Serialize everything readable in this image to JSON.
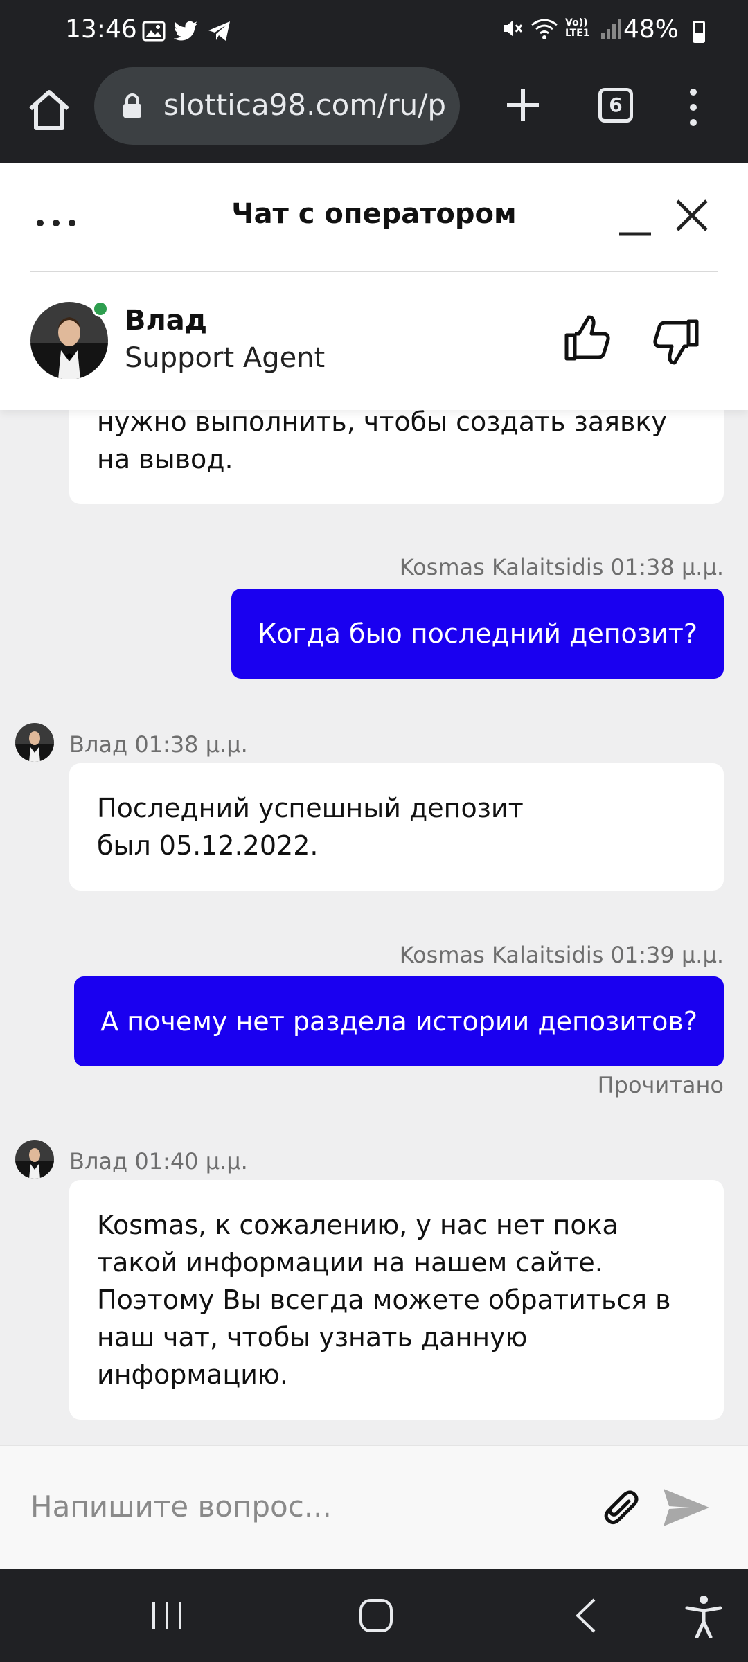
{
  "status_bar": {
    "time": "13:46",
    "battery": "48%",
    "icons_left": [
      "gallery-icon",
      "twitter-icon",
      "telegram-icon"
    ],
    "icons_right": [
      "mute-icon",
      "wifi-icon",
      "volte-icon",
      "signal-icon",
      "battery-icon"
    ],
    "volte_label": "Vo)) LTE1"
  },
  "browser": {
    "url": "slottica98.com/ru/p",
    "tab_count": "6"
  },
  "chat": {
    "title": "Чат с оператором",
    "agent_name": "Влад",
    "agent_role": "Support Agent",
    "online": true,
    "accent_color": "#1a00f0"
  },
  "messages": [
    {
      "from": "agent",
      "text": "нужно выполнить, чтобы создать заявку на вывод."
    },
    {
      "from": "user",
      "meta": "Kosmas Kalaitsidis 01:38 μ.μ.",
      "text": "Когда быо последний депозит?"
    },
    {
      "from": "agent",
      "meta": "Влад 01:38 μ.μ.",
      "text": "Последний успешный депозит был 05.12.2022."
    },
    {
      "from": "user",
      "meta": "Kosmas Kalaitsidis 01:39 μ.μ.",
      "text": "А почему нет раздела истории депозитов?",
      "status": "Прочитано"
    },
    {
      "from": "agent",
      "meta": "Влад 01:40 μ.μ.",
      "text": "Kosmas, к сожалению, у нас нет пока такой информации на нашем сайте. Поэтому Вы всегда можете обратиться в наш чат, чтобы узнать данную информацию."
    }
  ],
  "input": {
    "placeholder": "Напишите вопрос..."
  }
}
